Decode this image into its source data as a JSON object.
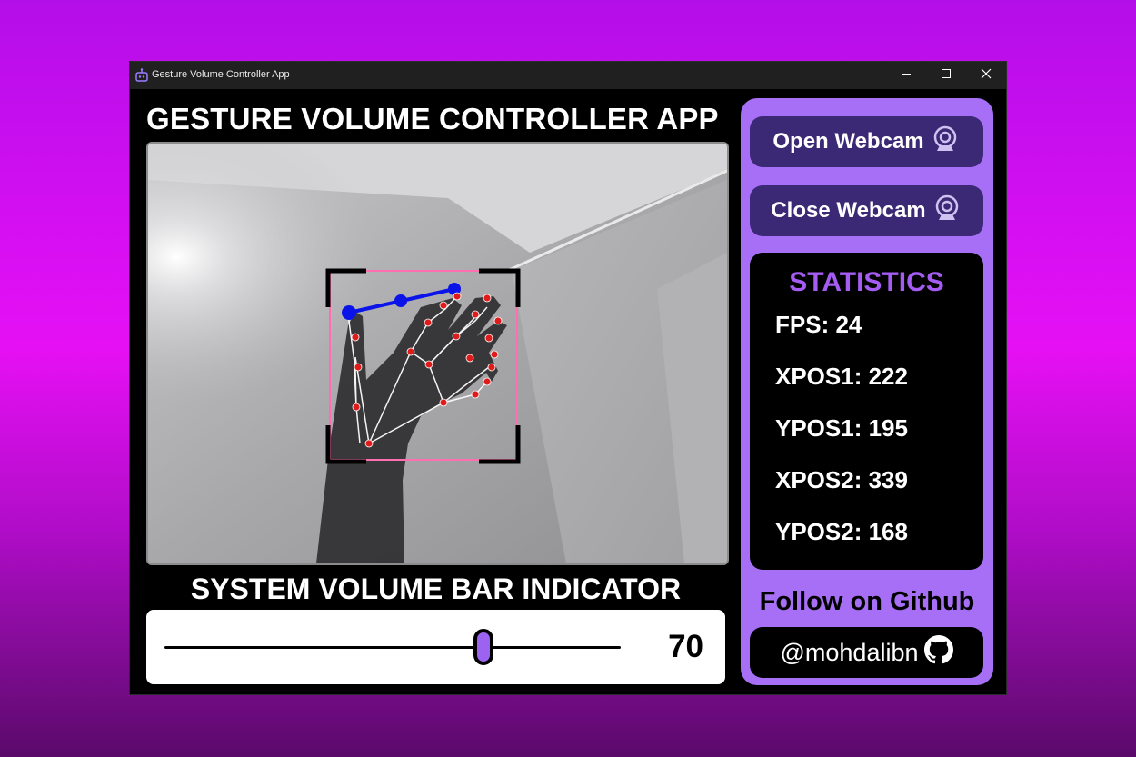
{
  "window": {
    "title": "Gesture Volume Controller App",
    "app_icon": "robot-icon",
    "controls": [
      "minimize-icon",
      "maximize-icon",
      "close-icon"
    ]
  },
  "main": {
    "heading": "GESTURE VOLUME CONTROLLER APP",
    "webcam_feed": "webcam-image"
  },
  "volume": {
    "heading": "SYSTEM VOLUME BAR INDICATOR",
    "value": "70",
    "level_percent": 70
  },
  "sidebar": {
    "open_webcam_label": "Open Webcam",
    "close_webcam_label": "Close Webcam",
    "webcam_icon": "webcam-icon",
    "statistics": {
      "title": "STATISTICS",
      "fps": "FPS: 24",
      "xpos1": "XPOS1: 222",
      "ypos1": "YPOS1: 195",
      "xpos2": "XPOS2: 339",
      "ypos2": "YPOS2: 168"
    },
    "follow_label": "Follow on Github",
    "github_handle": "@mohdalibn",
    "github_icon": "github-icon"
  },
  "colors": {
    "accent": "#a76ff5",
    "button": "#3b2975",
    "stats_title": "#a45cf3",
    "landmark_dot": "#e01b1b",
    "pinch_line": "#0a14e8",
    "hand_box": "#ff6fb0"
  }
}
